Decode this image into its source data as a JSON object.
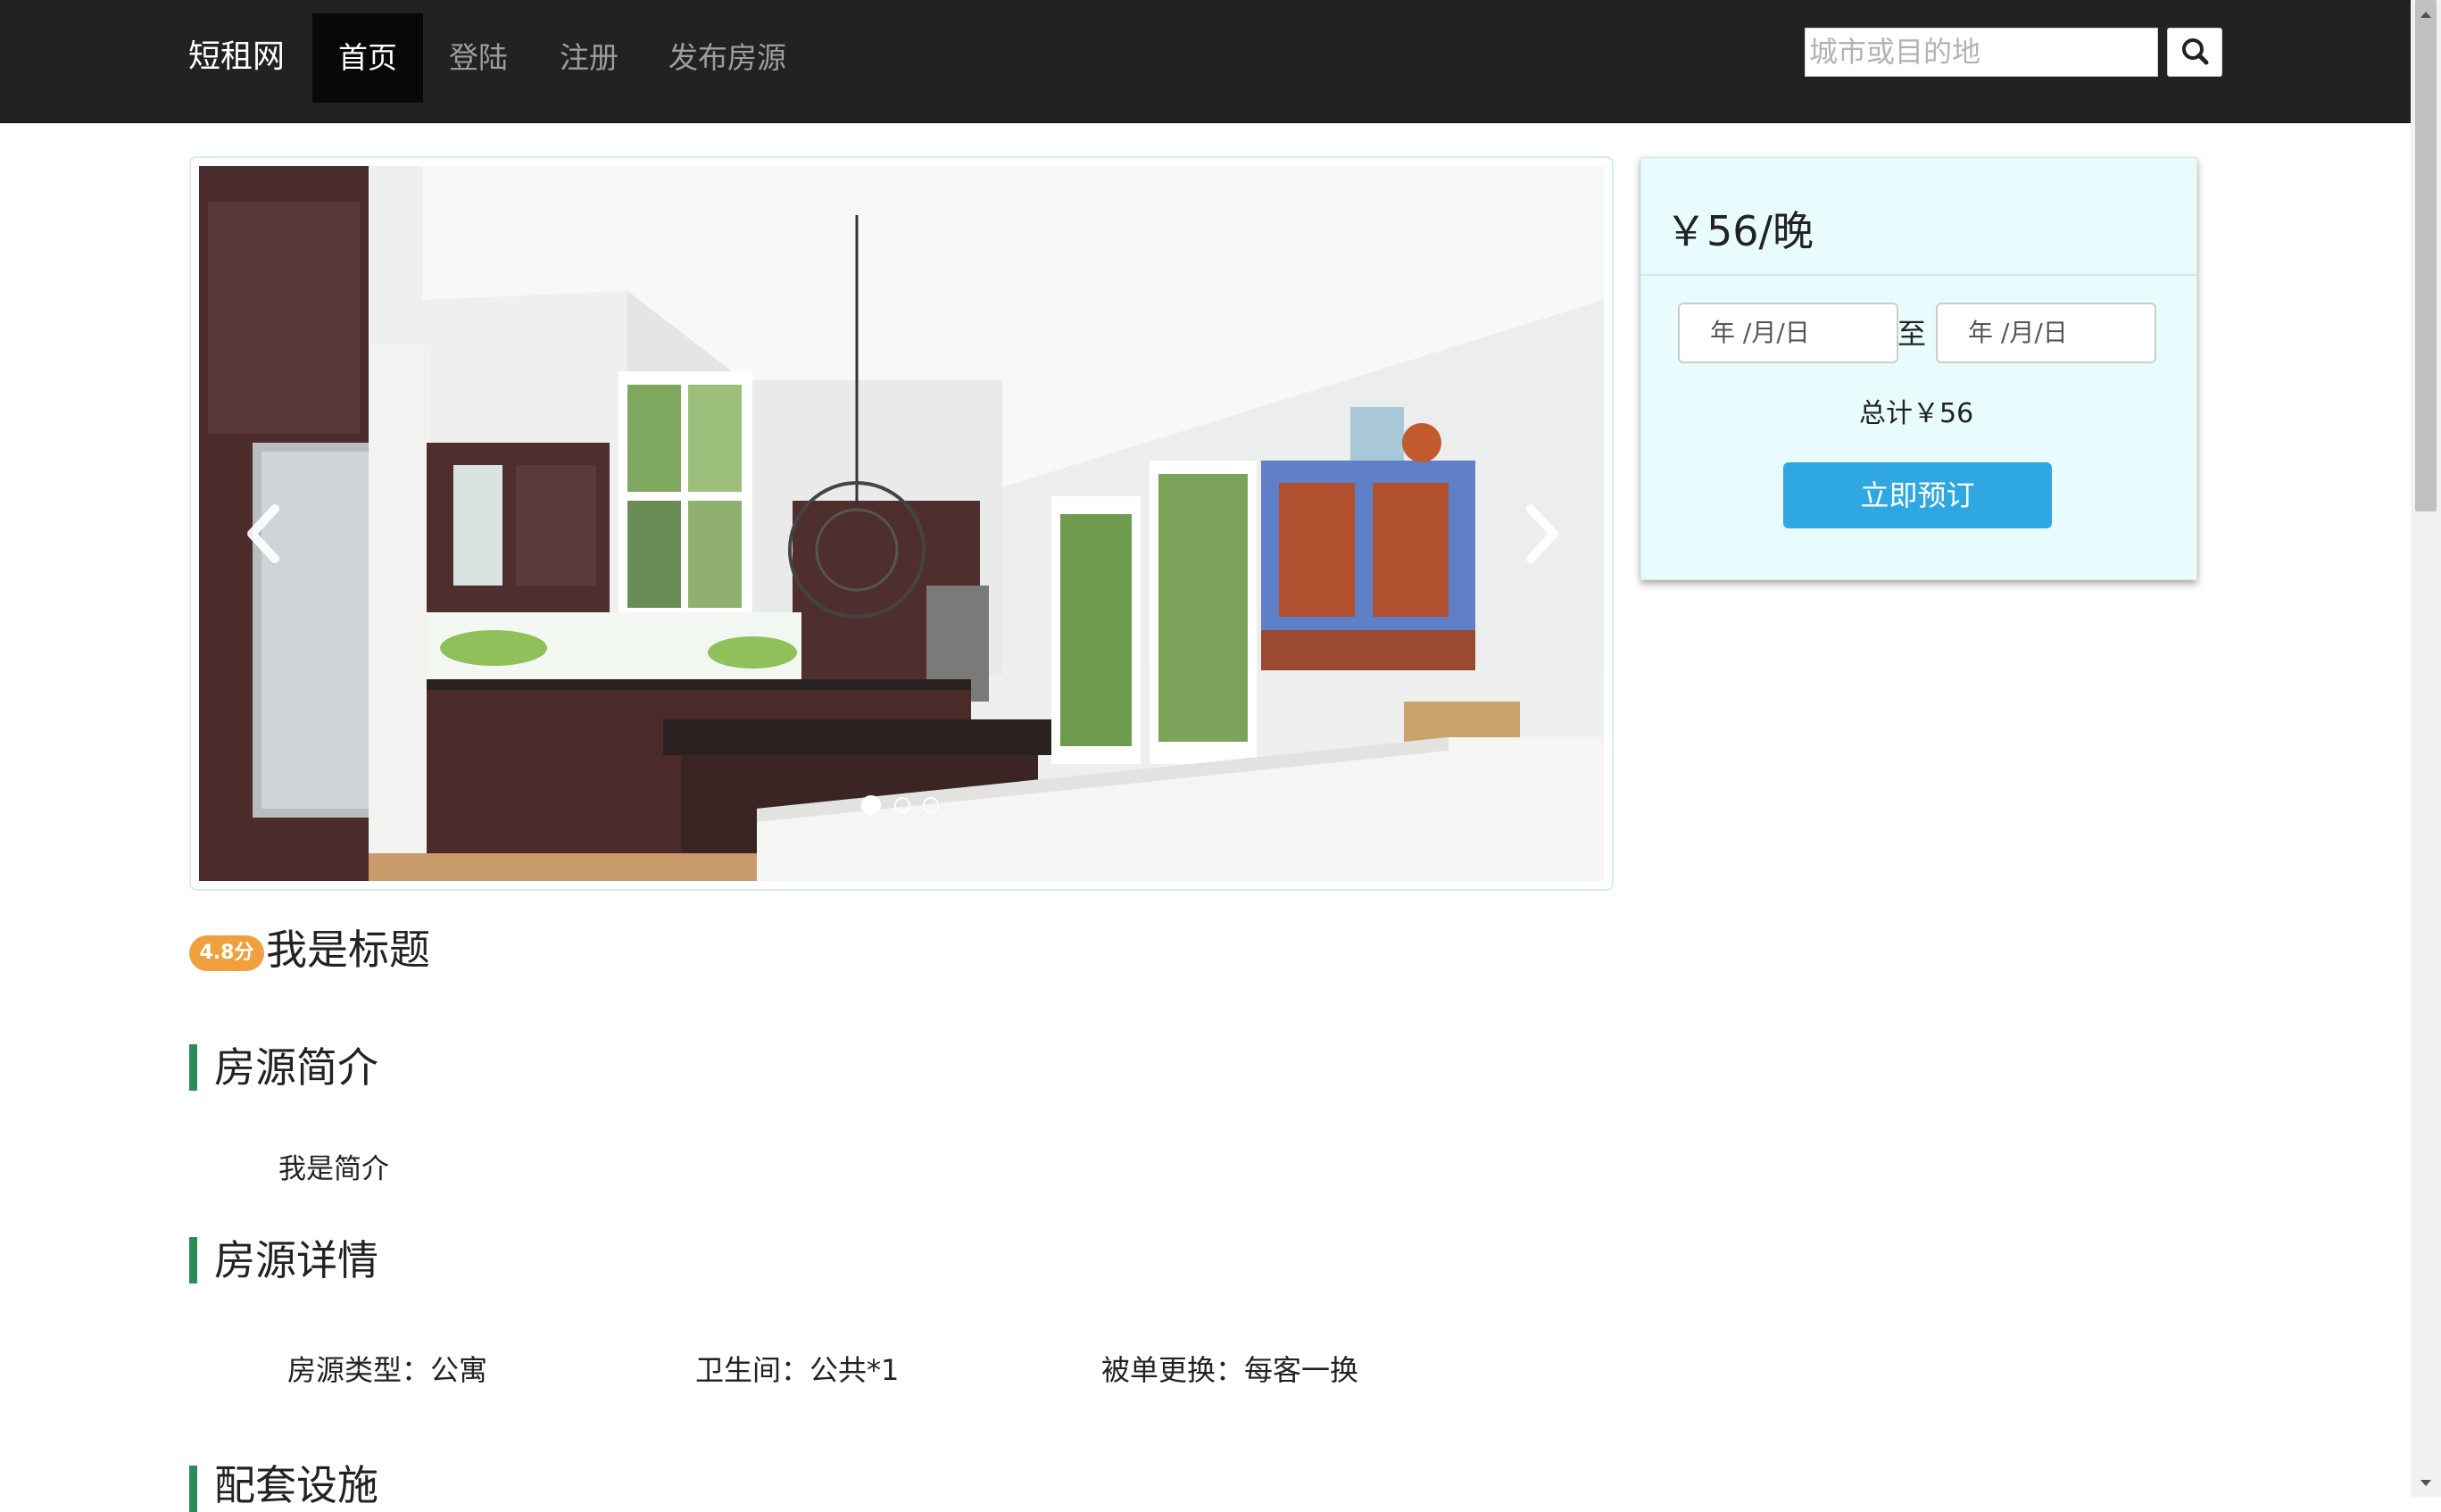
{
  "navbar": {
    "brand": "短租网",
    "items": [
      {
        "label": "首页",
        "active": true
      },
      {
        "label": "登陆",
        "active": false
      },
      {
        "label": "注册",
        "active": false
      },
      {
        "label": "发布房源",
        "active": false
      }
    ],
    "search_placeholder": "城市或目的地",
    "search_icon": "search-icon"
  },
  "carousel": {
    "slide_count": 3,
    "active_index": 0,
    "prev_icon": "chevron-left-icon",
    "next_icon": "chevron-right-icon"
  },
  "booking": {
    "price": "￥56/晚",
    "date_from_placeholder": "年 /月/日",
    "date_to_placeholder": "年 /月/日",
    "to_label": "至",
    "total": "总计￥56",
    "book_button": "立即预订"
  },
  "listing": {
    "rating": "4.8分",
    "title": "我是标题"
  },
  "sections": {
    "intro_title": "房源简介",
    "intro_text": "我是简介",
    "details_title": "房源详情",
    "details": [
      "房源类型：公寓",
      "卫生间：公共*1",
      "被单更换：每客一换"
    ],
    "facilities_title": "配套设施"
  },
  "colors": {
    "navbar_bg": "#222222",
    "accent_green": "#2e8b57",
    "book_button": "#2fa8e1",
    "rating_badge": "#f0a03c",
    "panel_bg": "#e8fcfd"
  }
}
